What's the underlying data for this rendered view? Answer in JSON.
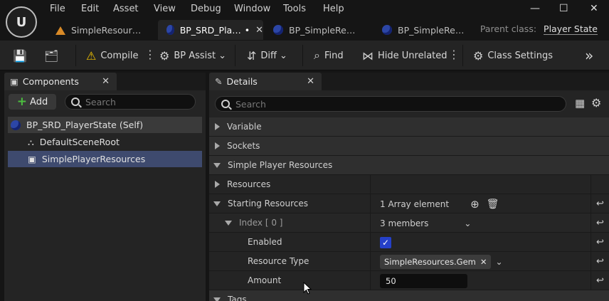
{
  "menu": [
    "File",
    "Edit",
    "Asset",
    "View",
    "Debug",
    "Window",
    "Tools",
    "Help"
  ],
  "window_controls": {
    "minimize": "—",
    "maximize": "☐",
    "close": "✕"
  },
  "tabs": [
    {
      "label": "SimpleResour…",
      "icon": "asset-warning-icon"
    },
    {
      "label": "BP_SRD_Pla…",
      "modified": "•",
      "icon": "blueprint-icon"
    },
    {
      "label": "BP_SimpleRe…",
      "icon": "blueprint-icon"
    },
    {
      "label": "BP_SimpleRe…",
      "icon": "blueprint-icon"
    }
  ],
  "parent_class": {
    "label": "Parent class:",
    "value": "Player State"
  },
  "toolbar": {
    "compile": "Compile",
    "bp_assist": "BP Assist",
    "diff": "Diff",
    "find": "Find",
    "hide_unrelated": "Hide Unrelated",
    "class_settings": "Class Settings",
    "expand": "»"
  },
  "components": {
    "title": "Components",
    "add_label": "Add",
    "search_placeholder": "Search",
    "tree": [
      {
        "label": "BP_SRD_PlayerState (Self)"
      },
      {
        "label": "DefaultSceneRoot"
      },
      {
        "label": "SimplePlayerResources"
      }
    ]
  },
  "details": {
    "title": "Details",
    "search_placeholder": "Search",
    "rows": {
      "variable": "Variable",
      "sockets": "Sockets",
      "simple_player_resources": "Simple Player Resources",
      "resources": "Resources",
      "starting_resources": "Starting Resources",
      "starting_resources_value": "1 Array element",
      "index": "Index [ 0 ]",
      "index_value": "3 members",
      "enabled": "Enabled",
      "enabled_value": "✓",
      "resource_type": "Resource Type",
      "resource_type_value": "SimpleResources.Gem",
      "amount": "Amount",
      "amount_value": "50",
      "tags": "Tags"
    }
  },
  "colors": {
    "selection": "#3e4a6e",
    "checkbox": "#2540c8",
    "add_plus": "#4cbf3f"
  }
}
